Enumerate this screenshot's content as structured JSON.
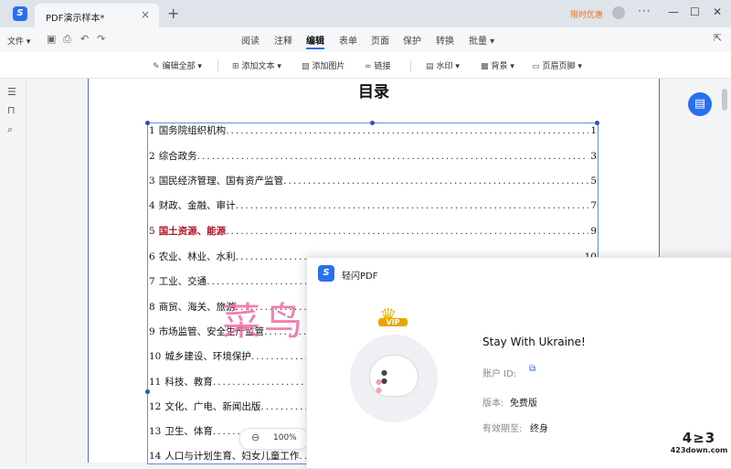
{
  "titlebar": {
    "tab_title": "PDF演示样本*",
    "tab_close": "×",
    "new_tab": "+",
    "promo": "限时优惠",
    "more": "···",
    "minimize": "—",
    "maximize": "☐",
    "close": "✕"
  },
  "menubar": {
    "file": "文件 ▾",
    "tabs": [
      "阅读",
      "注释",
      "编辑",
      "表单",
      "页面",
      "保护",
      "转换",
      "批量 ▾"
    ],
    "active_tab": "编辑"
  },
  "toolbar": {
    "edit_all": "编辑全部 ▾",
    "add_text": "添加文本 ▾",
    "add_image": "添加图片",
    "link": "链接",
    "watermark": "水印 ▾",
    "background": "背景 ▾",
    "header_footer": "页眉页脚 ▾"
  },
  "document": {
    "title": "目录",
    "toc": [
      {
        "num": "1",
        "text": "国务院组织机构",
        "page": "1"
      },
      {
        "num": "2",
        "text": "综合政务",
        "page": "3"
      },
      {
        "num": "3",
        "text": "国民经济管理、国有资产监管",
        "page": "5"
      },
      {
        "num": "4",
        "text": "财政、金融、审计",
        "page": "7"
      },
      {
        "num": "5",
        "text": "国土资源、能源",
        "page": "9"
      },
      {
        "num": "6",
        "text": "农业、林业、水利",
        "page": "10"
      },
      {
        "num": "7",
        "text": "工业、交通",
        "page": ""
      },
      {
        "num": "8",
        "text": "商贸、海关、旅游",
        "page": ""
      },
      {
        "num": "9",
        "text": "市场监管、安全生产监管",
        "page": ""
      },
      {
        "num": "10",
        "text": "城乡建设、环境保护",
        "page": ""
      },
      {
        "num": "11",
        "text": "科技、教育",
        "page": ""
      },
      {
        "num": "12",
        "text": "文化、广电、新闻出版",
        "page": ""
      },
      {
        "num": "13",
        "text": "卫生、体育",
        "page": ""
      },
      {
        "num": "14",
        "text": "人口与计划生育、妇女儿童工作",
        "page": ""
      }
    ],
    "watermark": "菜鸟资源"
  },
  "zoom": {
    "out": "⊖",
    "level": "100%"
  },
  "popup": {
    "app_name": "轻闪PDF",
    "vip": "VIP",
    "greeting": "Stay With Ukraine!",
    "account_id_label": "账户 ID:",
    "version_label": "版本:",
    "version_value": "免费版",
    "validity_label": "有效期至:",
    "validity_value": "终身"
  },
  "site_watermark": {
    "logo": "4≥3",
    "url": "423down.com"
  },
  "colors": {
    "accent": "#2a6ff0",
    "promo": "#e07a2e",
    "highlight_text": "#b2172b",
    "watermark": "#f06aa0"
  }
}
